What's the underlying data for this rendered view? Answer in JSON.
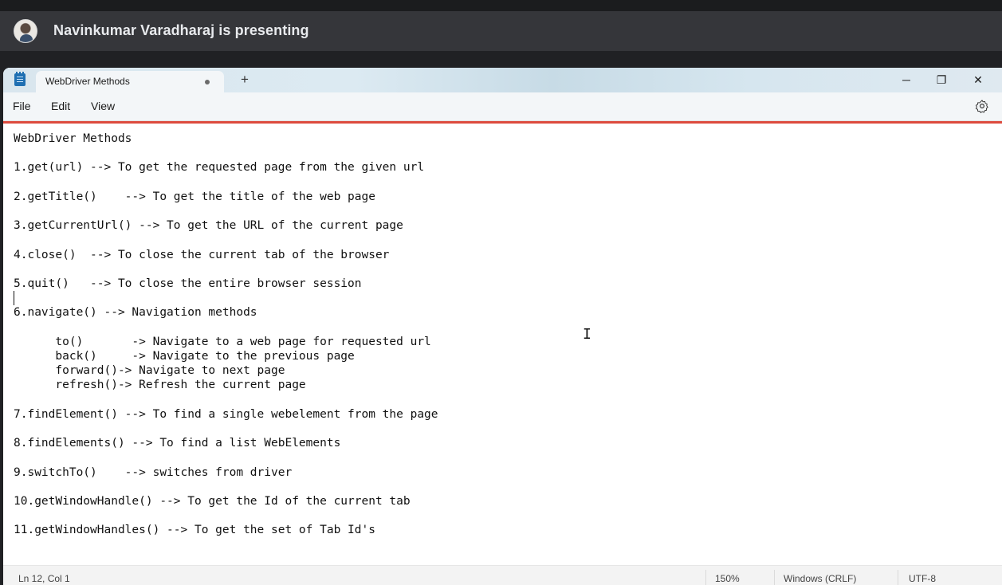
{
  "presenter": {
    "text": "Navinkumar Varadharaj is presenting"
  },
  "app": {
    "tab_title": "WebDriver Methods",
    "new_tab_symbol": "+",
    "controls": {
      "minimize": "─",
      "restore": "❐",
      "close": "✕"
    },
    "menu": {
      "file": "File",
      "edit": "Edit",
      "view": "View"
    },
    "icons": {
      "app": "notepad-icon",
      "settings": "gear-icon",
      "unsaved": "unsaved-dot-icon"
    },
    "accent_color": "#dd4b3e"
  },
  "editor": {
    "content": "WebDriver Methods\n\n1.get(url) --> To get the requested page from the given url\n\n2.getTitle()    --> To get the title of the web page\n\n3.getCurrentUrl() --> To get the URL of the current page\n\n4.close()  --> To close the current tab of the browser\n\n5.quit()   --> To close the entire browser session\n\n6.navigate() --> Navigation methods\n\n      to()       -> Navigate to a web page for requested url\n      back()     -> Navigate to the previous page\n      forward()-> Navigate to next page\n      refresh()-> Refresh the current page\n\n7.findElement() --> To find a single webelement from the page\n\n8.findElements() --> To find a list WebElements\n\n9.switchTo()    --> switches from driver\n\n10.getWindowHandle() --> To get the Id of the current tab\n\n11.getWindowHandles() --> To get the set of Tab Id's"
  },
  "status": {
    "position": "Ln 12, Col 1",
    "zoom": "150%",
    "line_ending": "Windows (CRLF)",
    "encoding": "UTF-8"
  }
}
